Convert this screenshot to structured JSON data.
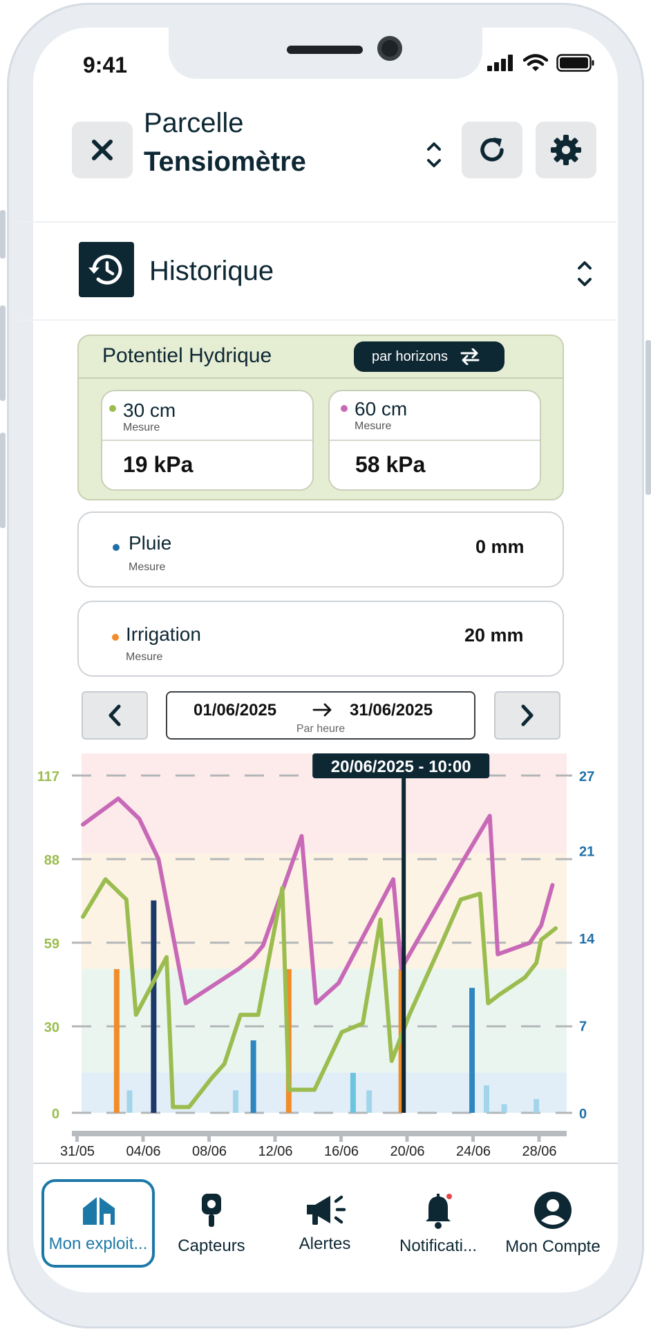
{
  "status": {
    "time": "9:41"
  },
  "header": {
    "subtitle": "Parcelle",
    "title": "Tensiomètre"
  },
  "section": {
    "label": "Historique"
  },
  "potentiel": {
    "title": "Potentiel Hydrique",
    "mode_label": "par horizons",
    "horizons": [
      {
        "depth": "30 cm",
        "kind": "Mesure",
        "value": "19 kPa",
        "color": "#9bbd4f"
      },
      {
        "depth": "60 cm",
        "kind": "Mesure",
        "value": "58 kPa",
        "color": "#c869b7"
      }
    ]
  },
  "pluie": {
    "label": "Pluie",
    "kind": "Mesure",
    "value": "0 mm",
    "color": "#1e6fa8"
  },
  "irrigation": {
    "label": "Irrigation",
    "kind": "Mesure",
    "value": "20 mm",
    "color": "#f28c28"
  },
  "date_range": {
    "start": "01/06/2025",
    "end": "31/06/2025",
    "resolution": "Par heure"
  },
  "chart_data": {
    "type": "line",
    "tooltip": "20/06/2025 - 10:00",
    "x_ticks": [
      "31/05",
      "04/06",
      "08/06",
      "12/06",
      "16/06",
      "20/06",
      "24/06",
      "28/06"
    ],
    "y_left_ticks": [
      "0",
      "30",
      "59",
      "88",
      "117"
    ],
    "y_right_ticks": [
      "0",
      "7",
      "14",
      "21",
      "27"
    ],
    "ylim_left": [
      0,
      117
    ],
    "ylim_right": [
      0,
      27
    ],
    "xlim": [
      0,
      30
    ],
    "colors": {
      "left_axis": "#9bbd4f",
      "right_axis": "#1e6fa8"
    },
    "series": [
      {
        "name": "60 cm",
        "color": "#c869b7",
        "x": [
          0,
          2.2,
          3.5,
          4.7,
          6.4,
          9.7,
          10.6,
          11.2,
          13.6,
          14.5,
          15.9,
          19.3,
          19.8,
          23.7,
          25.3,
          25.8,
          27.8,
          28.5,
          29.2
        ],
        "y": [
          100,
          109,
          102,
          88,
          38,
          50,
          54,
          58,
          96,
          38,
          45,
          81,
          50,
          88,
          103,
          55,
          59,
          65,
          79
        ]
      },
      {
        "name": "30 cm",
        "color": "#9bbd4f",
        "x": [
          0,
          1.4,
          2.7,
          3.3,
          5.2,
          5.6,
          6.6,
          8.0,
          8.8,
          9.8,
          10.9,
          12.4,
          12.8,
          14.4,
          16.1,
          17.4,
          18.5,
          19.2,
          20.3,
          22.4,
          23.5,
          24.7,
          25.2,
          25.9,
          27.5,
          28.2,
          28.5,
          29.4
        ],
        "y": [
          68,
          81,
          74,
          34,
          54,
          2,
          2,
          12,
          17,
          34,
          34,
          78,
          8,
          8,
          28,
          31,
          67,
          18,
          34,
          60,
          74,
          76,
          38,
          41,
          47,
          52,
          60,
          64
        ]
      }
    ],
    "bars": [
      {
        "x": 2.1,
        "value": 11.5,
        "color": "#f28c28"
      },
      {
        "x": 2.9,
        "value": 1.8,
        "color": "#a3d5ea"
      },
      {
        "x": 4.4,
        "value": 17,
        "color": "#1b3a6b"
      },
      {
        "x": 9.5,
        "value": 1.8,
        "color": "#a3d5ea"
      },
      {
        "x": 10.6,
        "value": 5.8,
        "color": "#2e86c1"
      },
      {
        "x": 12.8,
        "value": 11.5,
        "color": "#f28c28"
      },
      {
        "x": 16.8,
        "value": 3.2,
        "color": "#6cc4de"
      },
      {
        "x": 17.8,
        "value": 1.8,
        "color": "#a3d5ea"
      },
      {
        "x": 19.8,
        "value": 11.5,
        "color": "#f28c28"
      },
      {
        "x": 24.2,
        "value": 10,
        "color": "#2e86c1"
      },
      {
        "x": 25.1,
        "value": 2.2,
        "color": "#a3d5ea"
      },
      {
        "x": 26.2,
        "value": 0.7,
        "color": "#a3d5ea"
      },
      {
        "x": 28.2,
        "value": 1.1,
        "color": "#a3d5ea"
      }
    ],
    "zones": [
      {
        "from": 90,
        "to": 126,
        "color": "#fdeaea"
      },
      {
        "from": 50,
        "to": 90,
        "color": "#fdf3e4"
      },
      {
        "from": 14,
        "to": 50,
        "color": "#ebf5f0"
      },
      {
        "from": 0,
        "to": 14,
        "color": "#e2eef7"
      }
    ],
    "cursor_x": 19.95
  },
  "bottom_nav": [
    {
      "label": "Mon exploit...",
      "icon": "farm-icon",
      "active": true
    },
    {
      "label": "Capteurs",
      "icon": "sensor-icon",
      "active": false
    },
    {
      "label": "Alertes",
      "icon": "megaphone-icon",
      "active": false
    },
    {
      "label": "Notificati...",
      "icon": "bell-icon",
      "active": false
    },
    {
      "label": "Mon Compte",
      "icon": "account-icon",
      "active": false
    }
  ]
}
